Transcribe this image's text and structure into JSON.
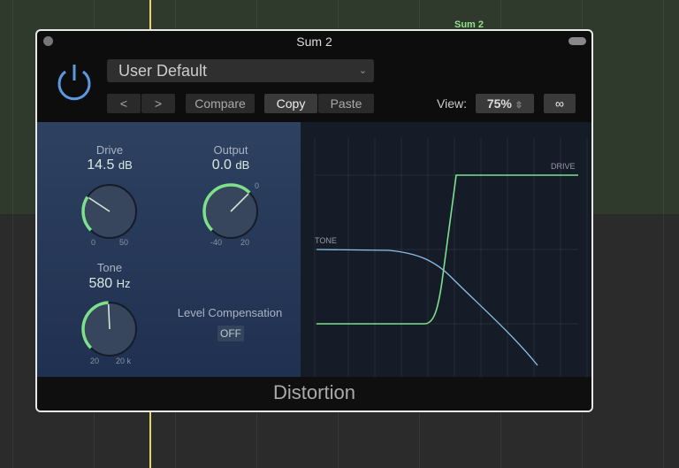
{
  "daw": {
    "region_label": "Sum 2"
  },
  "window": {
    "title": "Sum 2",
    "preset": "User Default",
    "buttons": {
      "prev": "<",
      "next": ">",
      "compare": "Compare",
      "copy": "Copy",
      "paste": "Paste"
    },
    "view_label": "View:",
    "view_value": "75%",
    "plugin_name": "Distortion"
  },
  "controls": {
    "drive": {
      "label": "Drive",
      "value": "14.5",
      "unit": "dB",
      "min": "0",
      "max": "50",
      "fraction": 0.29
    },
    "output": {
      "label": "Output",
      "value": "0.0",
      "unit": "dB",
      "min": "-40",
      "max": "20",
      "zero": "0",
      "fraction": 0.667
    },
    "tone": {
      "label": "Tone",
      "value": "580",
      "unit": "Hz",
      "min": "20",
      "max": "20 k",
      "fraction": 0.49
    },
    "level_comp": {
      "label": "Level Compensation",
      "value": "OFF"
    }
  },
  "graph": {
    "drive_label": "DRIVE",
    "tone_label": "TONE"
  },
  "colors": {
    "accent": "#7de08a",
    "power": "#5b9ae0",
    "tone_curve": "#8cc0e8"
  }
}
